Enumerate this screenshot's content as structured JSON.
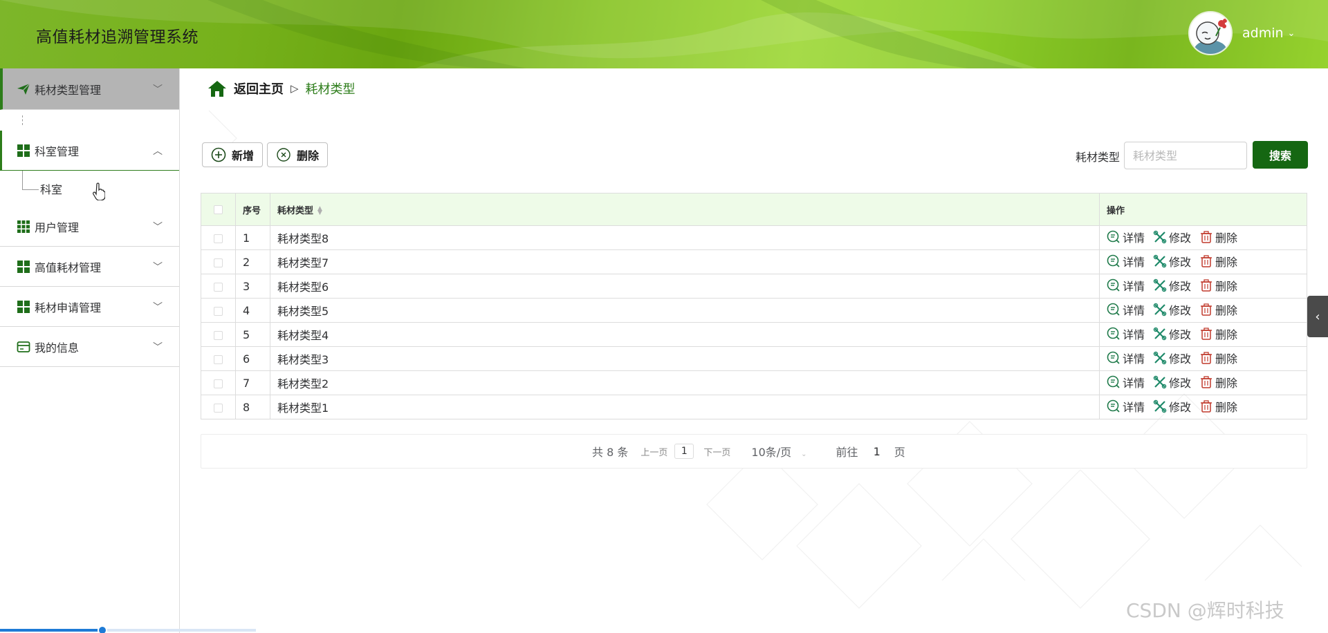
{
  "header": {
    "title": "高值耗材追溯管理系统",
    "username": "admin",
    "accent": "#7db62a"
  },
  "sidebar": {
    "items": [
      {
        "label": "耗材类型管理",
        "icon": "paper-plane-icon",
        "state": "active"
      },
      {
        "label": "科室管理",
        "icon": "grid-icon",
        "state": "expanded",
        "children": [
          {
            "label": "科室"
          }
        ]
      },
      {
        "label": "用户管理",
        "icon": "grid-9-icon",
        "state": "collapsed"
      },
      {
        "label": "高值耗材管理",
        "icon": "grid-icon",
        "state": "collapsed"
      },
      {
        "label": "耗材申请管理",
        "icon": "grid-icon",
        "state": "collapsed"
      },
      {
        "label": "我的信息",
        "icon": "card-icon",
        "state": "collapsed"
      }
    ]
  },
  "breadcrumb": {
    "home": "返回主页",
    "separator": "▷",
    "current": "耗材类型"
  },
  "toolbar": {
    "add_label": "新增",
    "delete_label": "删除",
    "search_label": "耗材类型",
    "search_placeholder": "耗材类型",
    "search_button": "搜索"
  },
  "table": {
    "columns": {
      "index": "序号",
      "type": "耗材类型",
      "ops": "操作"
    },
    "ops": {
      "detail": "详情",
      "edit": "修改",
      "delete": "删除"
    },
    "rows": [
      {
        "index": "1",
        "type": "耗材类型8"
      },
      {
        "index": "2",
        "type": "耗材类型7"
      },
      {
        "index": "3",
        "type": "耗材类型6"
      },
      {
        "index": "4",
        "type": "耗材类型5"
      },
      {
        "index": "5",
        "type": "耗材类型4"
      },
      {
        "index": "6",
        "type": "耗材类型3"
      },
      {
        "index": "7",
        "type": "耗材类型2"
      },
      {
        "index": "8",
        "type": "耗材类型1"
      }
    ]
  },
  "pagination": {
    "total": "共 8 条",
    "prev": "上一页",
    "current_page": "1",
    "next": "下一页",
    "page_size": "10条/页",
    "goto_label": "前往",
    "goto_value": "1",
    "page_suffix": "页"
  },
  "watermark": "CSDN @辉时科技",
  "progress": {
    "value": 0.4
  },
  "colors": {
    "brand_green": "#156712",
    "active_border": "#2d7d1a",
    "table_header_bg": "#eefbe8",
    "op_icon_green": "#1f7a4a",
    "op_icon_red": "#c0392b"
  }
}
